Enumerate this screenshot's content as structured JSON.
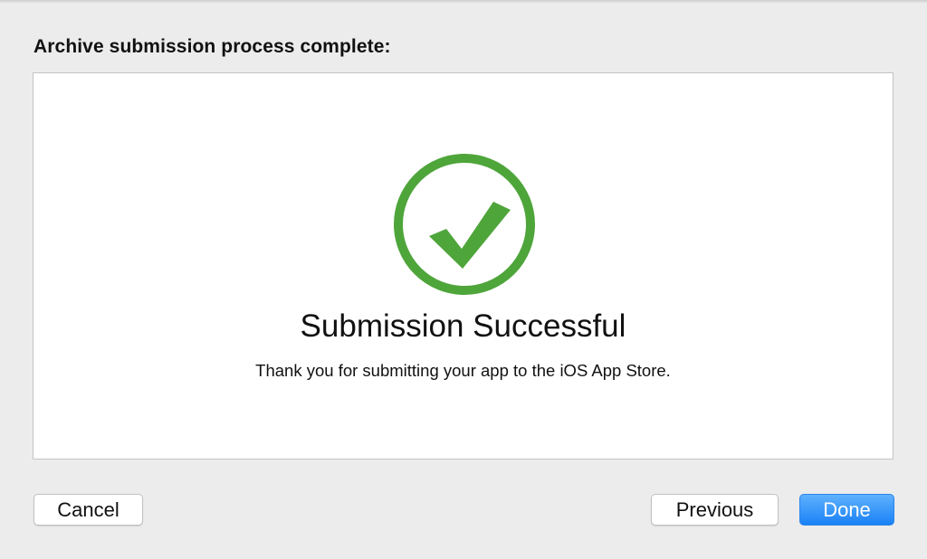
{
  "header": {
    "title": "Archive submission process complete:"
  },
  "panel": {
    "status_icon": "checkmark-circle-icon",
    "status_color": "#4ea53a",
    "title": "Submission Successful",
    "message": "Thank you for submitting your app to the iOS App Store."
  },
  "buttons": {
    "cancel_label": "Cancel",
    "previous_label": "Previous",
    "done_label": "Done",
    "done_color": "#1f86f7"
  }
}
